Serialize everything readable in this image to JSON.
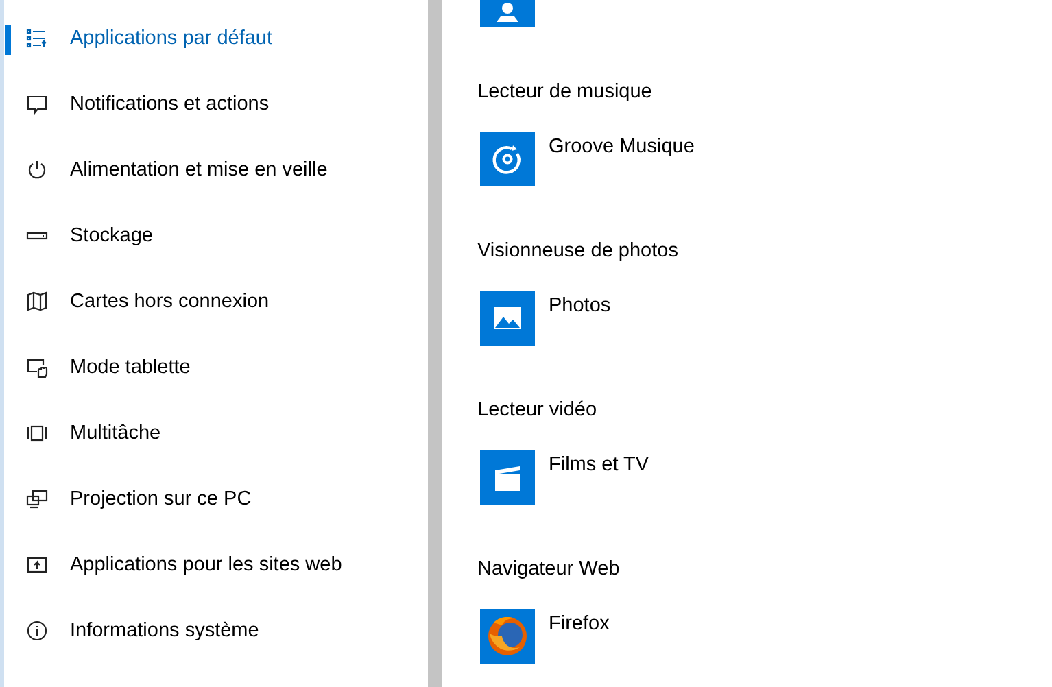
{
  "sidebar": {
    "items": [
      {
        "label": "Applications par défaut",
        "kind": "default-apps",
        "selected": true
      },
      {
        "label": "Notifications et actions",
        "kind": "notifications",
        "selected": false
      },
      {
        "label": "Alimentation et mise en veille",
        "kind": "power",
        "selected": false
      },
      {
        "label": "Stockage",
        "kind": "storage",
        "selected": false
      },
      {
        "label": "Cartes hors connexion",
        "kind": "maps",
        "selected": false
      },
      {
        "label": "Mode tablette",
        "kind": "tablet",
        "selected": false
      },
      {
        "label": "Multitâche",
        "kind": "multitask",
        "selected": false
      },
      {
        "label": "Projection sur ce PC",
        "kind": "projection",
        "selected": false
      },
      {
        "label": "Applications pour les sites web",
        "kind": "web-apps",
        "selected": false
      },
      {
        "label": "Informations système",
        "kind": "info",
        "selected": false
      }
    ]
  },
  "content": {
    "sections": [
      {
        "heading": "Lecteur de musique",
        "app": {
          "name": "Groove Musique",
          "kind": "groove"
        }
      },
      {
        "heading": "Visionneuse de photos",
        "app": {
          "name": "Photos",
          "kind": "photos"
        }
      },
      {
        "heading": "Lecteur vidéo",
        "app": {
          "name": "Films et TV",
          "kind": "films"
        }
      },
      {
        "heading": "Navigateur Web",
        "app": {
          "name": "Firefox",
          "kind": "firefox"
        }
      }
    ]
  }
}
